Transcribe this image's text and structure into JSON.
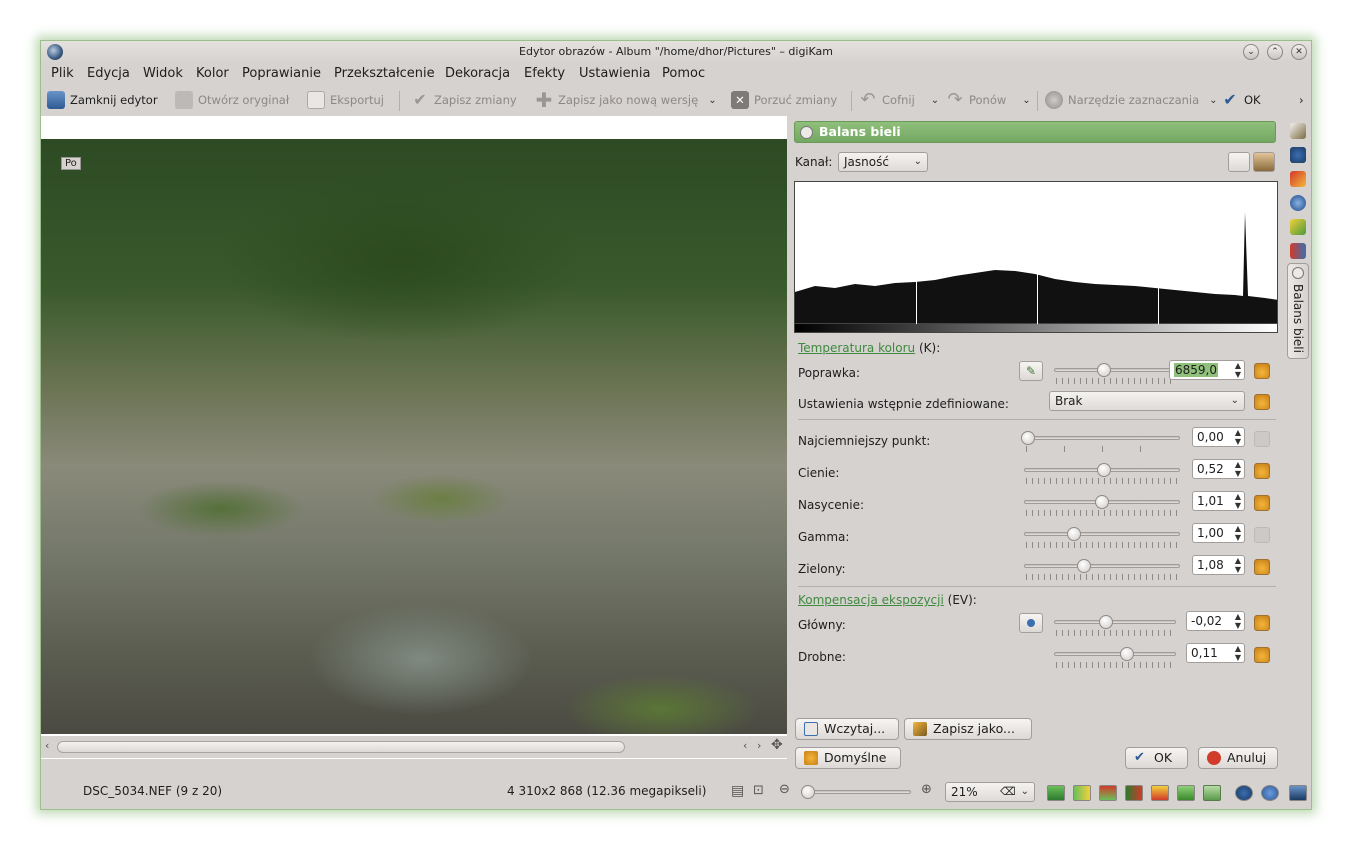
{
  "window": {
    "title": "Edytor obrazów - Album \"/home/dhor/Pictures\" – digiKam",
    "controls": [
      "chevron-down-icon",
      "chevron-up-icon",
      "close-icon"
    ]
  },
  "menu": [
    "Plik",
    "Edycja",
    "Widok",
    "Kolor",
    "Poprawianie",
    "Przekształcenie",
    "Dekoracja",
    "Efekty",
    "Ustawienia",
    "Pomoc"
  ],
  "toolbar": {
    "close_editor": "Zamknij edytor",
    "open_original": "Otwórz oryginał",
    "export": "Eksportuj",
    "save_changes": "Zapisz zmiany",
    "save_as_new_version": "Zapisz jako nową wersję",
    "discard_changes": "Porzuć zmiany",
    "undo": "Cofnij",
    "redo": "Ponów",
    "selection_tool": "Narzędzie zaznaczania",
    "ok": "OK",
    "more": "›"
  },
  "canvas": {
    "overlay_label": "Po",
    "scroll_left": "‹",
    "scroll_right": "›"
  },
  "tool": {
    "title": "Balans bieli",
    "channel_label": "Kanał:",
    "channel_value": "Jasność",
    "temperature_link": "Temperatura koloru",
    "temperature_unit": " (K):",
    "correction_label": "Poprawka:",
    "correction_value": "6859,0",
    "preset_label": "Ustawienia wstępnie zdefiniowane:",
    "preset_value": "Brak",
    "darkest_label": "Najciemniejszy punkt:",
    "darkest_value": "0,00",
    "darkest_level": 0.0,
    "shadows_label": "Cienie:",
    "shadows_value": "0,52",
    "saturation_label": "Nasycenie:",
    "saturation_value": "1,01",
    "gamma_label": "Gamma:",
    "gamma_value": "1,00",
    "green_label": "Zielony:",
    "green_value": "1,08",
    "exposure_link": "Kompensacja ekspozycji",
    "exposure_unit": " (EV):",
    "main_label": "Główny:",
    "main_value": "-0,02",
    "fine_label": "Drobne:",
    "fine_value": "0,11",
    "load_button": "Wczytaj...",
    "save_as_button": "Zapisz jako...",
    "defaults_button": "Domyślne",
    "ok_button": "OK",
    "cancel_button": "Anuluj"
  },
  "sidebar": {
    "active_tab": "Balans bieli"
  },
  "status": {
    "filename": "DSC_5034.NEF (9 z 20)",
    "dimensions": "4 310x2 868 (12.36 megapikseli)",
    "zoom_value": "21%"
  }
}
